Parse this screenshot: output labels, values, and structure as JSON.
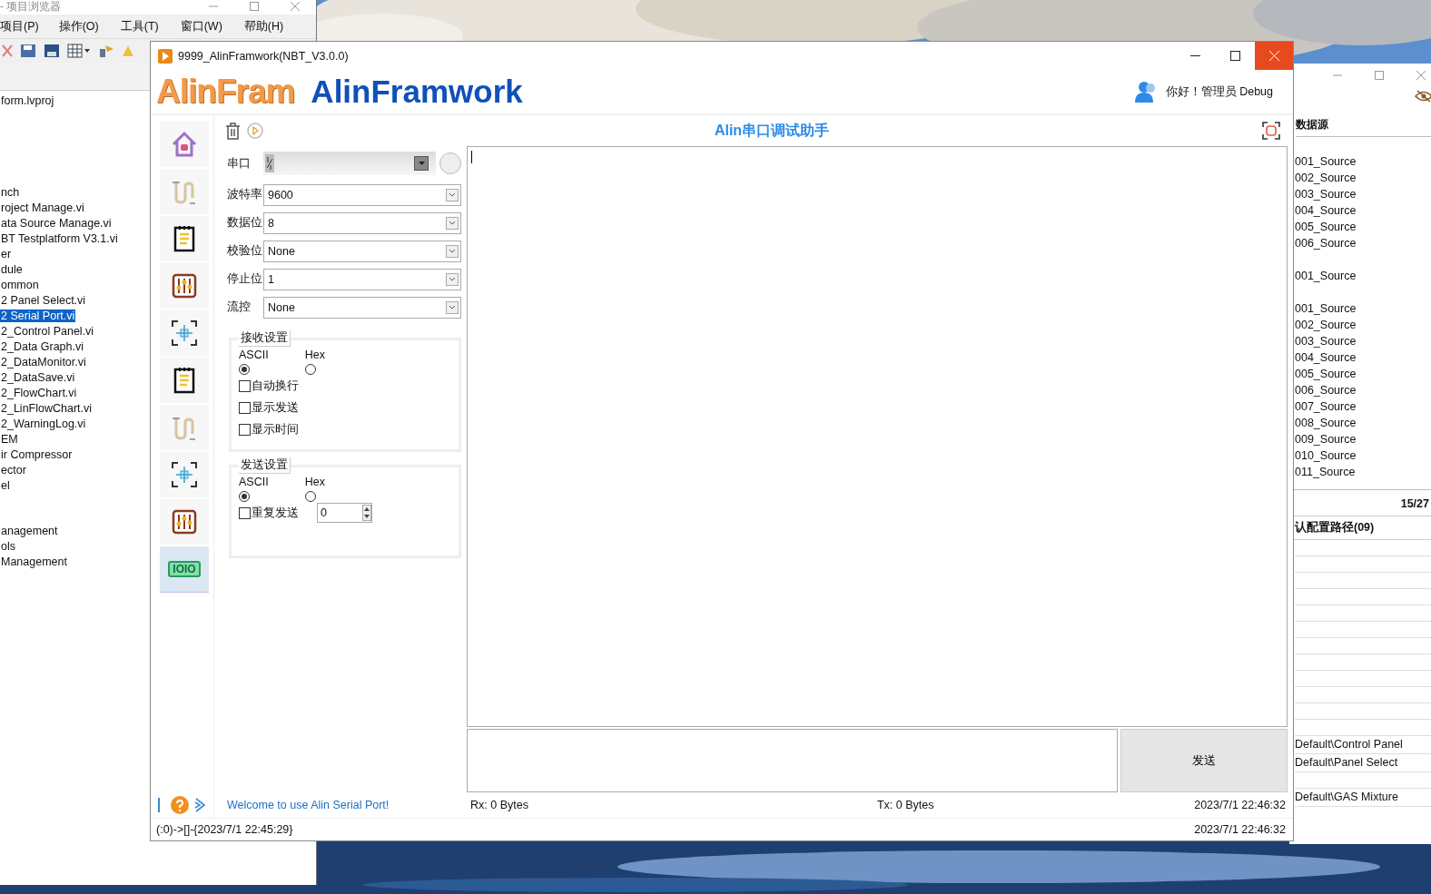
{
  "project_window": {
    "title": "- 项目浏览器",
    "menu": [
      "项目(P)",
      "操作(O)",
      "工具(T)",
      "窗口(W)",
      "帮助(H)"
    ],
    "tree_groups": [
      [
        {
          "label": "form.lvproj",
          "selected": false
        }
      ],
      [
        {
          "label": "nch",
          "selected": false
        },
        {
          "label": "roject Manage.vi",
          "selected": false
        },
        {
          "label": "ata Source Manage.vi",
          "selected": false
        },
        {
          "label": "BT Testplatform V3.1.vi",
          "selected": false
        },
        {
          "label": "er",
          "selected": false
        },
        {
          "label": "dule",
          "selected": false
        },
        {
          "label": "ommon",
          "selected": false
        },
        {
          "label": "2 Panel Select.vi",
          "selected": false
        },
        {
          "label": "2 Serial Port.vi",
          "selected": true
        },
        {
          "label": "2_Control Panel.vi",
          "selected": false
        },
        {
          "label": "2_Data Graph.vi",
          "selected": false
        },
        {
          "label": "2_DataMonitor.vi",
          "selected": false
        },
        {
          "label": "2_DataSave.vi",
          "selected": false
        },
        {
          "label": "2_FlowChart.vi",
          "selected": false
        },
        {
          "label": "2_LinFlowChart.vi",
          "selected": false
        },
        {
          "label": "2_WarningLog.vi",
          "selected": false
        },
        {
          "label": "EM",
          "selected": false
        },
        {
          "label": "ir Compressor",
          "selected": false
        },
        {
          "label": "ector",
          "selected": false
        },
        {
          "label": "el",
          "selected": false
        }
      ],
      [
        {
          "label": "anagement",
          "selected": false
        },
        {
          "label": "ols",
          "selected": false
        },
        {
          "label": "Management",
          "selected": false
        }
      ]
    ]
  },
  "source_window": {
    "header": "数据源",
    "source_groups": [
      [
        "001_Source",
        "002_Source",
        "003_Source",
        "004_Source",
        "005_Source",
        "006_Source"
      ],
      [
        "001_Source"
      ],
      [
        "001_Source",
        "002_Source",
        "003_Source",
        "004_Source",
        "005_Source",
        "006_Source",
        "007_Source",
        "008_Source",
        "009_Source",
        "010_Source",
        "011_Source"
      ]
    ],
    "count": "15/27",
    "path_header": "认配置路径(09)",
    "paths": [
      "Default\\Control Panel",
      "Default\\Panel Select",
      "Default\\GAS Mixture"
    ]
  },
  "window": {
    "title": "9999_AlinFramwork(NBT_V3.0.0)"
  },
  "header": {
    "logo": "AlinFram",
    "brand": "AlinFramwork",
    "greeting": "你好！管理员 Debug"
  },
  "sidebar": [
    {
      "kind": "home",
      "selected": false
    },
    {
      "kind": "pipe",
      "selected": false
    },
    {
      "kind": "notepad",
      "selected": false
    },
    {
      "kind": "sliders",
      "selected": false
    },
    {
      "kind": "crosshair",
      "selected": false
    },
    {
      "kind": "notepad",
      "selected": false
    },
    {
      "kind": "pipe",
      "selected": false
    },
    {
      "kind": "crosshair",
      "selected": false
    },
    {
      "kind": "sliders",
      "selected": false
    },
    {
      "kind": "binary",
      "selected": true,
      "label": "IOIO"
    }
  ],
  "panel_title": "Alin串口调试助手",
  "settings": [
    {
      "kind": "resource",
      "label": "串口",
      "indicator_on": false
    },
    {
      "kind": "combo",
      "label": "波特率",
      "value": "9600"
    },
    {
      "kind": "combo",
      "label": "数据位",
      "value": "8"
    },
    {
      "kind": "combo",
      "label": "校验位",
      "value": "None"
    },
    {
      "kind": "combo",
      "label": "停止位",
      "value": "1"
    },
    {
      "kind": "combo",
      "label": "流控",
      "value": "None"
    }
  ],
  "receive": {
    "title": "接收设置",
    "radios": [
      {
        "label": "ASCII",
        "selected": true
      },
      {
        "label": "Hex",
        "selected": false
      }
    ],
    "options": [
      {
        "label": "自动换行",
        "checked": false
      },
      {
        "label": "显示发送",
        "checked": false
      },
      {
        "label": "显示时间",
        "checked": false
      }
    ]
  },
  "send": {
    "title": "发送设置",
    "radios": [
      {
        "label": "ASCII",
        "selected": true
      },
      {
        "label": "Hex",
        "selected": false
      }
    ],
    "repeat": {
      "label": "重复发送",
      "checked": false,
      "value": "0"
    }
  },
  "send_button": "发送",
  "footer": {
    "welcome": "Welcome to use Alin Serial Port!",
    "rx": "Rx:  0 Bytes",
    "tx": "Tx:  0 Bytes",
    "time": "2023/7/1 22:46:32"
  },
  "status_bar": {
    "log": "(:0)->[]-{2023/7/1 22:45:29}",
    "time": "2023/7/1 22:46:32"
  }
}
